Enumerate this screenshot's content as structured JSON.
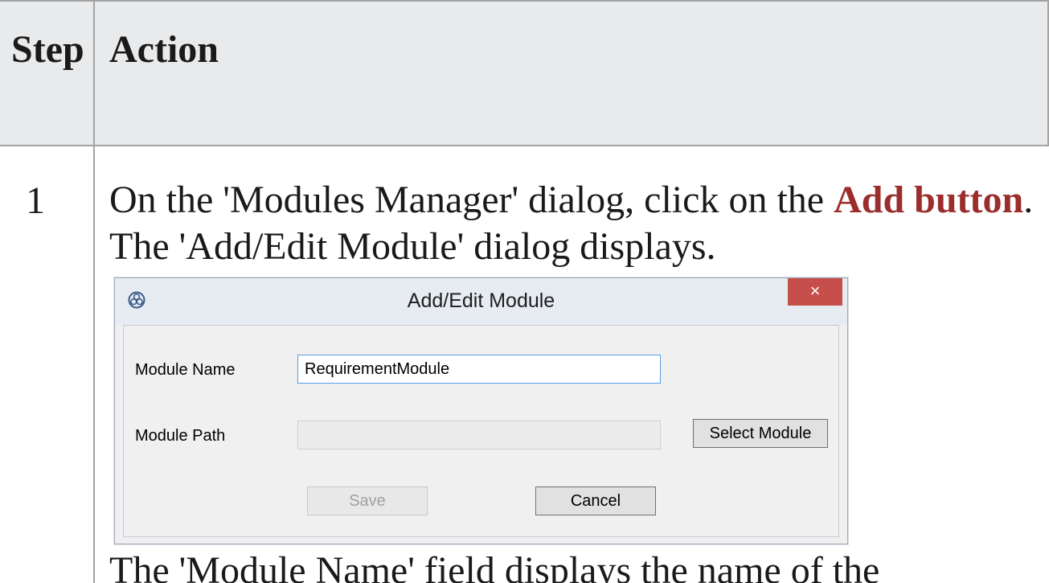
{
  "table": {
    "header_step": "Step",
    "header_action": "Action",
    "rows": [
      {
        "step": "1",
        "text_before": "On the 'Modules Manager' dialog, click on the ",
        "keyword": "Add button",
        "text_after": ". The 'Add/Edit Module' dialog displays.",
        "text_following": "The 'Module Name' field displays the name of the"
      }
    ]
  },
  "dialog": {
    "title": "Add/Edit Module",
    "close_label": "×",
    "module_name_label": "Module Name",
    "module_name_value": "RequirementModule",
    "module_path_label": "Module Path",
    "module_path_value": "",
    "select_module_label": "Select Module",
    "save_label": "Save",
    "cancel_label": "Cancel",
    "icon": "sparx-logo-icon"
  },
  "colors": {
    "keyword": "#9b2d2d",
    "header_bg": "#e8eaec",
    "close_button": "#c74f4b"
  }
}
